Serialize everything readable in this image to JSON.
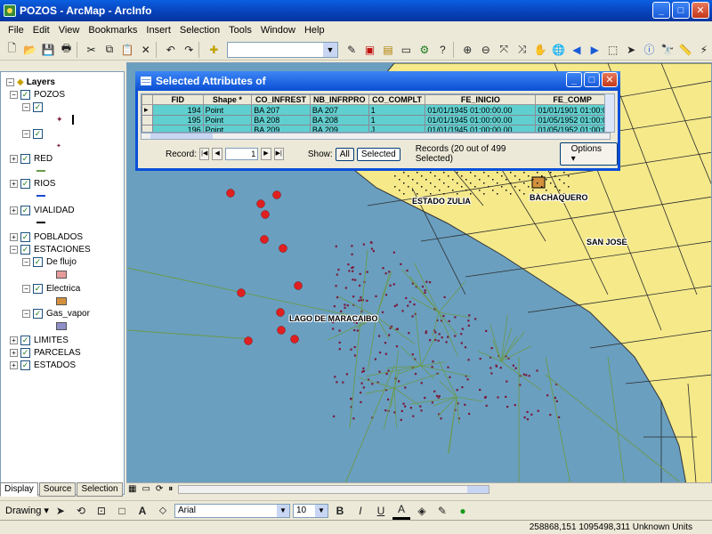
{
  "window": {
    "title": "POZOS - ArcMap - ArcInfo"
  },
  "menu": [
    "File",
    "Edit",
    "View",
    "Bookmarks",
    "Insert",
    "Selection",
    "Tools",
    "Window",
    "Help"
  ],
  "toc": {
    "root": "Layers",
    "layers": [
      {
        "name": "POZOS",
        "checked": true,
        "expanded": true
      },
      {
        "name": "RED",
        "checked": true,
        "expanded": false
      },
      {
        "name": "RIOS",
        "checked": true,
        "expanded": false
      },
      {
        "name": "VIALIDAD",
        "checked": true,
        "expanded": false
      },
      {
        "name": "POBLADOS",
        "checked": true,
        "expanded": false
      },
      {
        "name": "ESTACIONES",
        "checked": true,
        "expanded": true
      },
      {
        "name": "De flujo",
        "checked": true,
        "color": "#e79b9b"
      },
      {
        "name": "Electrica",
        "checked": true,
        "color": "#d4913d"
      },
      {
        "name": "Gas_vapor",
        "checked": true,
        "color": "#8e8ec8"
      },
      {
        "name": "LIMITES",
        "checked": true,
        "expanded": false
      },
      {
        "name": "PARCELAS",
        "checked": true,
        "expanded": false
      },
      {
        "name": "ESTADOS",
        "checked": true,
        "expanded": false
      }
    ],
    "tabs": [
      "Display",
      "Source",
      "Selection"
    ]
  },
  "attributes": {
    "title": "Selected Attributes of",
    "columns": [
      "FID",
      "Shape *",
      "CO_INFREST",
      "NB_INFRPRO",
      "CO_COMPLT",
      "FE_INICIO",
      "FE_COMP"
    ],
    "rows": [
      [
        "194",
        "Point",
        "BA 207",
        "BA 207",
        "1",
        "01/01/1945 01:00:00.00",
        "01/01/1901 01:00:0"
      ],
      [
        "195",
        "Point",
        "BA 208",
        "BA 208",
        "1",
        "01/01/1945 01:00:00.00",
        "01/05/1952 01:00:0"
      ],
      [
        "196",
        "Point",
        "BA 209",
        "BA 209",
        "J",
        "01/01/1945 01:00:00.00",
        "01/05/1952 01:00:0"
      ]
    ],
    "record_label": "Record:",
    "record_value": "1",
    "show_label": "Show:",
    "all_label": "All",
    "selected_label": "Selected",
    "records_text": "Records (20 out of 499 Selected)",
    "options_label": "Options"
  },
  "map_labels": {
    "estado_zulia": "ESTADO ZULIA",
    "bachaquero": "BACHAQUERO",
    "san_jose": "SAN JOSE",
    "lago": "LAGO DE MARACAIBO"
  },
  "colors": {
    "water": "#6a9fc0",
    "land": "#f5e98a",
    "road": "#2d2d2d",
    "well": "#7a1a3a",
    "station": "#e02020",
    "line": "#6a9a4a"
  },
  "drawing": {
    "label": "Drawing",
    "font": "Arial",
    "size": "10"
  },
  "status": {
    "coords": "258868,151  1095498,311 Unknown Units"
  }
}
